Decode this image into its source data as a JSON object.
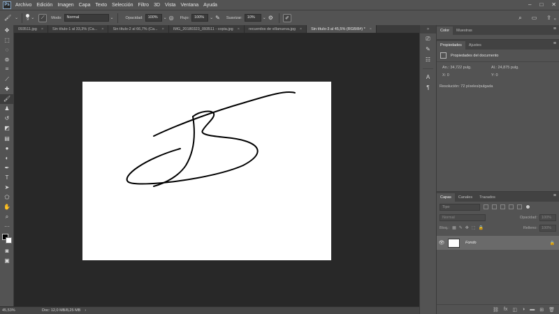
{
  "app": {
    "logo": "Ps",
    "window_controls": [
      "–",
      "□",
      "✕"
    ]
  },
  "menu": [
    "Archivo",
    "Edición",
    "Imagen",
    "Capa",
    "Texto",
    "Selección",
    "Filtro",
    "3D",
    "Vista",
    "Ventana",
    "Ayuda"
  ],
  "options": {
    "brush_size": "9",
    "mode_label": "Modo:",
    "mode_value": "Normal",
    "opacity_label": "Opacidad:",
    "opacity_value": "100%",
    "flow_label": "Flujo:",
    "flow_value": "100%",
    "smoothing_label": "Suavizar:",
    "smoothing_value": "10%"
  },
  "tabs": [
    {
      "label": "093511.jpg"
    },
    {
      "label": "Sin título-1 al 33,3% (Ca..."
    },
    {
      "label": "Sin título-2 al 66,7% (Ca..."
    },
    {
      "label": "IMG_20180323_093511 - copia.jpg"
    },
    {
      "label": "recuerdos de villanueva.jpg"
    },
    {
      "label": "Sin título-3 al 45,5% (RGB/8#) *"
    }
  ],
  "tools": [
    "move-icon",
    "marquee-icon",
    "lasso-icon",
    "quick-select-icon",
    "crop-icon",
    "eyedropper-icon",
    "healing-icon",
    "brush-icon",
    "stamp-icon",
    "history-brush-icon",
    "eraser-icon",
    "gradient-icon",
    "blur-icon",
    "dodge-icon",
    "pen-icon",
    "type-icon",
    "path-select-icon",
    "shape-icon",
    "hand-icon",
    "zoom-icon",
    "more-icon"
  ],
  "status": {
    "zoom": "45,53%",
    "doc_size": "Doc: 12,0 MB/8,25 MB",
    "arrow": "›"
  },
  "panels": {
    "color_tabs": [
      "Color",
      "Muestras"
    ],
    "props_tabs": [
      "Propiedades",
      "Ajustes"
    ],
    "props_title": "Propiedades del documento",
    "width_label": "An.:",
    "width_value": "34,722 pulg.",
    "height_label": "Al.:",
    "height_value": "24,875 pulg.",
    "x_label": "X:",
    "x_value": "0",
    "y_label": "Y:",
    "y_value": "0",
    "resolution": "Resolución: 72 píxeles/pulgada",
    "layers_tabs": [
      "Capas",
      "Canales",
      "Trazados"
    ],
    "layer_filter_placeholder": "Tipo",
    "blend_mode": "Normal",
    "opacity_label": "Opacidad:",
    "opacity_value": "100%",
    "lock_label": "Bloq.:",
    "fill_label": "Relleno:",
    "fill_value": "100%",
    "layer_name": "Fondo"
  }
}
